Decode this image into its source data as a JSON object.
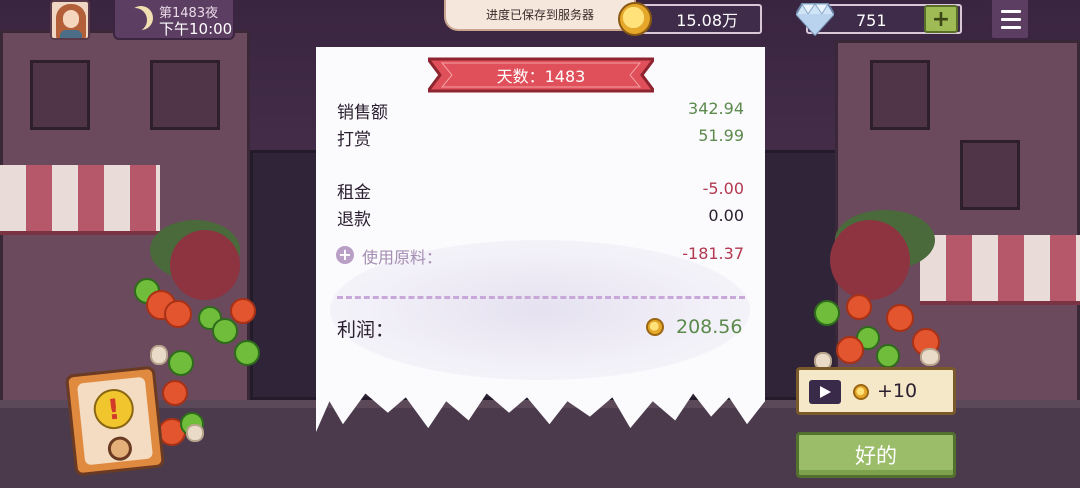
{
  "hud": {
    "night_label": "第1483夜",
    "time_label": "下午10:00",
    "save_toast": "进度已保存到服务器",
    "coins": "15.08万",
    "gems": "751",
    "plus_label": "+"
  },
  "receipt": {
    "day_label": "天数：1483",
    "rows": [
      {
        "label": "销售额",
        "value": "342.94"
      },
      {
        "label": "打赏",
        "value": "51.99"
      },
      {
        "label": "租金",
        "value": "-5.00"
      },
      {
        "label": "退款",
        "value": "0.00"
      }
    ],
    "materials": {
      "label": "使用原料：",
      "value": "-181.37"
    },
    "profit": {
      "label": "利润：",
      "value": "208.56"
    }
  },
  "actions": {
    "ad_reward": "+10",
    "ok_label": "好的"
  },
  "colors": {
    "positive": "#5b8a4d",
    "negative": "#b2394f",
    "banner": "#e0505a",
    "ok_button": "#9bbd6a"
  },
  "icons": [
    "moon-icon",
    "coin-icon",
    "gem-icon",
    "plus-icon",
    "menu-icon",
    "plus-circle-icon",
    "video-icon",
    "alert-icon"
  ]
}
